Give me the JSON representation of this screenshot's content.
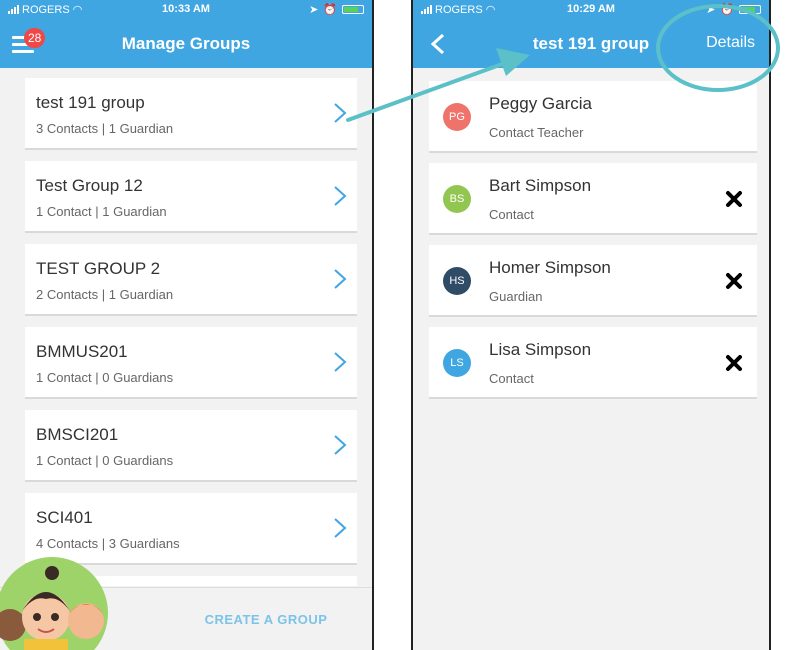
{
  "left": {
    "status": {
      "carrier": "ROGERS",
      "time": "10:33 AM"
    },
    "nav": {
      "title": "Manage Groups",
      "badge": "28"
    },
    "groups": [
      {
        "name": "test 191 group",
        "meta": "3 Contacts | 1 Guardian"
      },
      {
        "name": "Test Group 12",
        "meta": "1 Contact | 1 Guardian"
      },
      {
        "name": "TEST GROUP 2",
        "meta": "2 Contacts | 1 Guardian"
      },
      {
        "name": "BMMUS201",
        "meta": "1 Contact | 0 Guardians"
      },
      {
        "name": "BMSCI201",
        "meta": "1 Contact | 0 Guardians"
      },
      {
        "name": "SCI401",
        "meta": "4 Contacts | 3 Guardians"
      }
    ],
    "create_label": "CREATE A GROUP"
  },
  "right": {
    "status": {
      "carrier": "ROGERS",
      "time": "10:29 AM"
    },
    "nav": {
      "title": "test 191 group",
      "details_label": "Details"
    },
    "contacts": [
      {
        "initials": "PG",
        "name": "Peggy Garcia",
        "role": "Contact  Teacher",
        "color": "#f0736b"
      },
      {
        "initials": "BS",
        "name": "Bart Simpson",
        "role": "Contact",
        "color": "#93c651"
      },
      {
        "initials": "HS",
        "name": "Homer Simpson",
        "role": "Guardian",
        "color": "#2f4b66"
      },
      {
        "initials": "LS",
        "name": "Lisa Simpson",
        "role": "Contact",
        "color": "#3fa6e2"
      }
    ]
  },
  "colors": {
    "accent": "#3fa6e2",
    "annotation": "#5bc0c8",
    "create_text": "#7cc3e9"
  }
}
